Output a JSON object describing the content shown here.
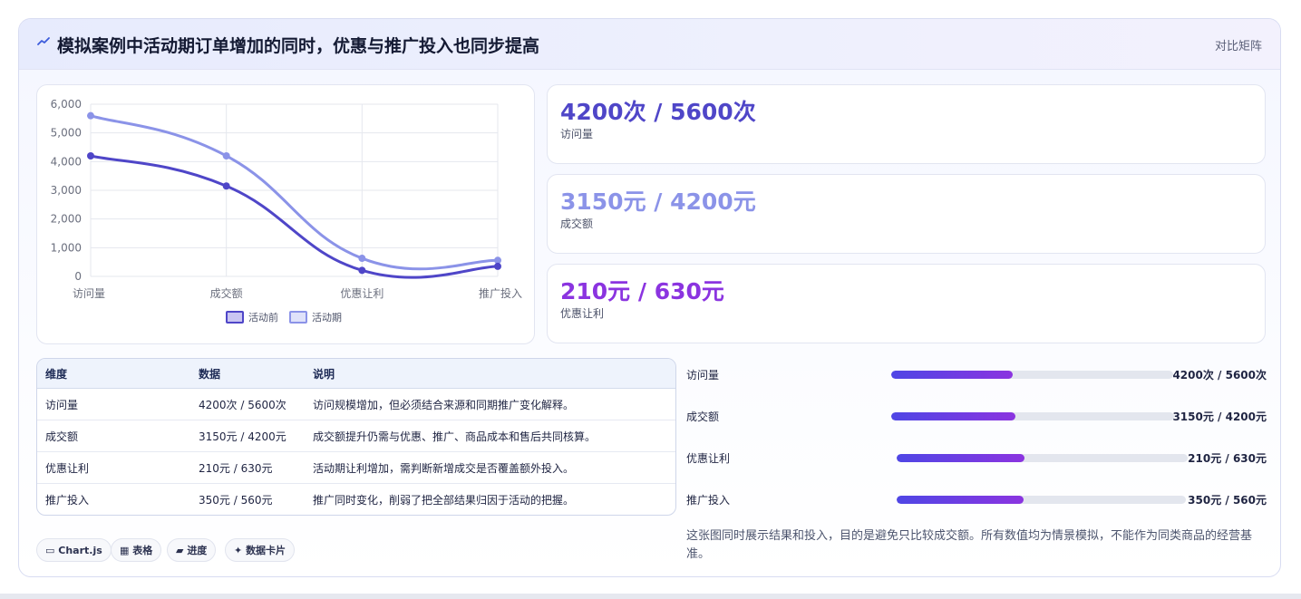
{
  "header": {
    "title": "模拟案例中活动期订单增加的同时，优惠与推广投入也同步提高",
    "icon": "trend-line-icon",
    "tag": "对比矩阵"
  },
  "colors": {
    "before": "#4f46c8",
    "during": "#8b93e8",
    "accent_purple": "#8b34e0"
  },
  "chart_data": {
    "type": "line",
    "categories": [
      "访问量",
      "成交额",
      "优惠让利",
      "推广投入"
    ],
    "series": [
      {
        "name": "活动前",
        "values": [
          4200,
          3150,
          210,
          350
        ]
      },
      {
        "name": "活动期",
        "values": [
          5600,
          4200,
          630,
          560
        ]
      }
    ],
    "yticks": [
      "0",
      "1,000",
      "2,000",
      "3,000",
      "4,000",
      "5,000",
      "6,000"
    ],
    "ylim": [
      0,
      6000
    ],
    "grid": true,
    "legend": "bottom",
    "xlabel": "",
    "ylabel": "",
    "title": ""
  },
  "kpis": [
    {
      "value": "4200次 / 5600次",
      "label": "访问量",
      "color": "#4f46c8"
    },
    {
      "value": "3150元 / 4200元",
      "label": "成交额",
      "color": "#8b93e8"
    },
    {
      "value": "210元 / 630元",
      "label": "优惠让利",
      "color": "#8b34e0"
    }
  ],
  "table": {
    "headers": [
      "维度",
      "数据",
      "说明"
    ],
    "rows": [
      [
        "访问量",
        "4200次 / 5600次",
        "访问规模增加，但必须结合来源和同期推广变化解释。"
      ],
      [
        "成交额",
        "3150元 / 4200元",
        "成交额提升仍需与优惠、推广、商品成本和售后共同核算。"
      ],
      [
        "优惠让利",
        "210元 / 630元",
        "活动期让利增加，需判断新增成交是否覆盖额外投入。"
      ],
      [
        "推广投入",
        "350元 / 560元",
        "推广同时变化，削弱了把全部结果归因于活动的把握。"
      ]
    ]
  },
  "progress": [
    {
      "label": "访问量",
      "value": "4200次 / 5600次",
      "fill": 0.43
    },
    {
      "label": "成交额",
      "value": "3150元 / 4200元",
      "fill": 0.44
    },
    {
      "label": "优惠让利",
      "value": "210元 / 630元",
      "fill": 0.44
    },
    {
      "label": "推广投入",
      "value": "350元 / 560元",
      "fill": 0.44
    }
  ],
  "chips": [
    {
      "icon": "chart-icon",
      "glyph": "▭",
      "label": "Chart.js"
    },
    {
      "icon": "table-icon",
      "glyph": "▦",
      "label": "表格"
    },
    {
      "icon": "folder-icon",
      "glyph": "▰",
      "label": "进度"
    },
    {
      "icon": "sparkle-icon",
      "glyph": "✦",
      "label": "数据卡片"
    }
  ],
  "note": "这张图同时展示结果和投入，目的是避免只比较成交额。所有数值均为情景模拟，不能作为同类商品的经营基准。"
}
